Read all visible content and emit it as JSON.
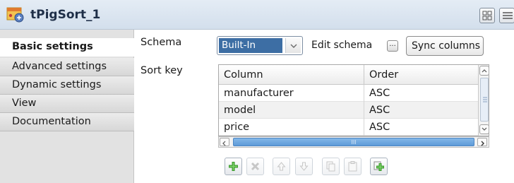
{
  "window": {
    "title": "tPigSort_1"
  },
  "nav": {
    "items": [
      {
        "label": "Basic settings",
        "active": true
      },
      {
        "label": "Advanced settings",
        "active": false
      },
      {
        "label": "Dynamic settings",
        "active": false
      },
      {
        "label": "View",
        "active": false
      },
      {
        "label": "Documentation",
        "active": false
      }
    ]
  },
  "form": {
    "schema_label": "Schema",
    "schema_value": "Built-In",
    "edit_schema_label": "Edit schema",
    "edit_schema_button": "...",
    "sync_columns_label": "Sync columns",
    "sort_key_label": "Sort key"
  },
  "sort_table": {
    "columns": [
      "Column",
      "Order"
    ],
    "rows": [
      {
        "column": "manufacturer",
        "order": "ASC"
      },
      {
        "column": "model",
        "order": "ASC"
      },
      {
        "column": "price",
        "order": "ASC"
      }
    ],
    "hscroll_grip": "III"
  },
  "toolbar": {
    "buttons": [
      {
        "icon": "add-icon",
        "enabled": true
      },
      {
        "icon": "remove-icon",
        "enabled": false
      },
      {
        "icon": "move-up-icon",
        "enabled": false
      },
      {
        "icon": "move-down-icon",
        "enabled": false
      },
      {
        "icon": "copy-icon",
        "enabled": false
      },
      {
        "icon": "paste-icon",
        "enabled": false
      },
      {
        "icon": "import-icon",
        "enabled": true
      }
    ]
  },
  "colors": {
    "nav_background": "#e2e2e2",
    "selection_blue": "#3d6ea4",
    "scroll_thumb": "#5e9bd8",
    "add_green": "#3c9b2e"
  }
}
